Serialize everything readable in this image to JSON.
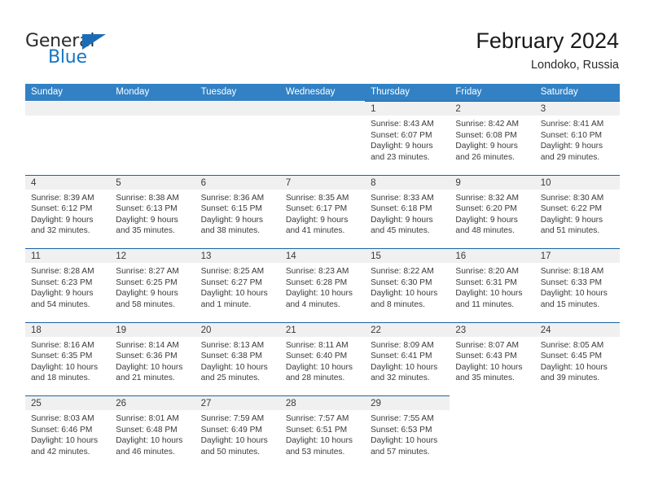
{
  "brand": {
    "name_part1": "General",
    "name_part2": "Blue",
    "triangle_icon": "brand-triangle-icon",
    "color_dark": "#2b2b2b",
    "color_blue": "#1577c4"
  },
  "header": {
    "title": "February 2024",
    "subtitle": "Londoko, Russia"
  },
  "theme": {
    "header_row_bg": "#3281c4",
    "cell_top_border": "#1b63a5",
    "date_band_bg": "#f0f0f0",
    "text": "#3a3a3a"
  },
  "calendar": {
    "weekdays": [
      "Sunday",
      "Monday",
      "Tuesday",
      "Wednesday",
      "Thursday",
      "Friday",
      "Saturday"
    ],
    "weeks": [
      [
        {
          "date": "",
          "sunrise": "",
          "sunset": "",
          "daylight_line1": "",
          "daylight_line2": ""
        },
        {
          "date": "",
          "sunrise": "",
          "sunset": "",
          "daylight_line1": "",
          "daylight_line2": ""
        },
        {
          "date": "",
          "sunrise": "",
          "sunset": "",
          "daylight_line1": "",
          "daylight_line2": ""
        },
        {
          "date": "",
          "sunrise": "",
          "sunset": "",
          "daylight_line1": "",
          "daylight_line2": ""
        },
        {
          "date": "1",
          "sunrise": "Sunrise: 8:43 AM",
          "sunset": "Sunset: 6:07 PM",
          "daylight_line1": "Daylight: 9 hours",
          "daylight_line2": "and 23 minutes."
        },
        {
          "date": "2",
          "sunrise": "Sunrise: 8:42 AM",
          "sunset": "Sunset: 6:08 PM",
          "daylight_line1": "Daylight: 9 hours",
          "daylight_line2": "and 26 minutes."
        },
        {
          "date": "3",
          "sunrise": "Sunrise: 8:41 AM",
          "sunset": "Sunset: 6:10 PM",
          "daylight_line1": "Daylight: 9 hours",
          "daylight_line2": "and 29 minutes."
        }
      ],
      [
        {
          "date": "4",
          "sunrise": "Sunrise: 8:39 AM",
          "sunset": "Sunset: 6:12 PM",
          "daylight_line1": "Daylight: 9 hours",
          "daylight_line2": "and 32 minutes."
        },
        {
          "date": "5",
          "sunrise": "Sunrise: 8:38 AM",
          "sunset": "Sunset: 6:13 PM",
          "daylight_line1": "Daylight: 9 hours",
          "daylight_line2": "and 35 minutes."
        },
        {
          "date": "6",
          "sunrise": "Sunrise: 8:36 AM",
          "sunset": "Sunset: 6:15 PM",
          "daylight_line1": "Daylight: 9 hours",
          "daylight_line2": "and 38 minutes."
        },
        {
          "date": "7",
          "sunrise": "Sunrise: 8:35 AM",
          "sunset": "Sunset: 6:17 PM",
          "daylight_line1": "Daylight: 9 hours",
          "daylight_line2": "and 41 minutes."
        },
        {
          "date": "8",
          "sunrise": "Sunrise: 8:33 AM",
          "sunset": "Sunset: 6:18 PM",
          "daylight_line1": "Daylight: 9 hours",
          "daylight_line2": "and 45 minutes."
        },
        {
          "date": "9",
          "sunrise": "Sunrise: 8:32 AM",
          "sunset": "Sunset: 6:20 PM",
          "daylight_line1": "Daylight: 9 hours",
          "daylight_line2": "and 48 minutes."
        },
        {
          "date": "10",
          "sunrise": "Sunrise: 8:30 AM",
          "sunset": "Sunset: 6:22 PM",
          "daylight_line1": "Daylight: 9 hours",
          "daylight_line2": "and 51 minutes."
        }
      ],
      [
        {
          "date": "11",
          "sunrise": "Sunrise: 8:28 AM",
          "sunset": "Sunset: 6:23 PM",
          "daylight_line1": "Daylight: 9 hours",
          "daylight_line2": "and 54 minutes."
        },
        {
          "date": "12",
          "sunrise": "Sunrise: 8:27 AM",
          "sunset": "Sunset: 6:25 PM",
          "daylight_line1": "Daylight: 9 hours",
          "daylight_line2": "and 58 minutes."
        },
        {
          "date": "13",
          "sunrise": "Sunrise: 8:25 AM",
          "sunset": "Sunset: 6:27 PM",
          "daylight_line1": "Daylight: 10 hours",
          "daylight_line2": "and 1 minute."
        },
        {
          "date": "14",
          "sunrise": "Sunrise: 8:23 AM",
          "sunset": "Sunset: 6:28 PM",
          "daylight_line1": "Daylight: 10 hours",
          "daylight_line2": "and 4 minutes."
        },
        {
          "date": "15",
          "sunrise": "Sunrise: 8:22 AM",
          "sunset": "Sunset: 6:30 PM",
          "daylight_line1": "Daylight: 10 hours",
          "daylight_line2": "and 8 minutes."
        },
        {
          "date": "16",
          "sunrise": "Sunrise: 8:20 AM",
          "sunset": "Sunset: 6:31 PM",
          "daylight_line1": "Daylight: 10 hours",
          "daylight_line2": "and 11 minutes."
        },
        {
          "date": "17",
          "sunrise": "Sunrise: 8:18 AM",
          "sunset": "Sunset: 6:33 PM",
          "daylight_line1": "Daylight: 10 hours",
          "daylight_line2": "and 15 minutes."
        }
      ],
      [
        {
          "date": "18",
          "sunrise": "Sunrise: 8:16 AM",
          "sunset": "Sunset: 6:35 PM",
          "daylight_line1": "Daylight: 10 hours",
          "daylight_line2": "and 18 minutes."
        },
        {
          "date": "19",
          "sunrise": "Sunrise: 8:14 AM",
          "sunset": "Sunset: 6:36 PM",
          "daylight_line1": "Daylight: 10 hours",
          "daylight_line2": "and 21 minutes."
        },
        {
          "date": "20",
          "sunrise": "Sunrise: 8:13 AM",
          "sunset": "Sunset: 6:38 PM",
          "daylight_line1": "Daylight: 10 hours",
          "daylight_line2": "and 25 minutes."
        },
        {
          "date": "21",
          "sunrise": "Sunrise: 8:11 AM",
          "sunset": "Sunset: 6:40 PM",
          "daylight_line1": "Daylight: 10 hours",
          "daylight_line2": "and 28 minutes."
        },
        {
          "date": "22",
          "sunrise": "Sunrise: 8:09 AM",
          "sunset": "Sunset: 6:41 PM",
          "daylight_line1": "Daylight: 10 hours",
          "daylight_line2": "and 32 minutes."
        },
        {
          "date": "23",
          "sunrise": "Sunrise: 8:07 AM",
          "sunset": "Sunset: 6:43 PM",
          "daylight_line1": "Daylight: 10 hours",
          "daylight_line2": "and 35 minutes."
        },
        {
          "date": "24",
          "sunrise": "Sunrise: 8:05 AM",
          "sunset": "Sunset: 6:45 PM",
          "daylight_line1": "Daylight: 10 hours",
          "daylight_line2": "and 39 minutes."
        }
      ],
      [
        {
          "date": "25",
          "sunrise": "Sunrise: 8:03 AM",
          "sunset": "Sunset: 6:46 PM",
          "daylight_line1": "Daylight: 10 hours",
          "daylight_line2": "and 42 minutes."
        },
        {
          "date": "26",
          "sunrise": "Sunrise: 8:01 AM",
          "sunset": "Sunset: 6:48 PM",
          "daylight_line1": "Daylight: 10 hours",
          "daylight_line2": "and 46 minutes."
        },
        {
          "date": "27",
          "sunrise": "Sunrise: 7:59 AM",
          "sunset": "Sunset: 6:49 PM",
          "daylight_line1": "Daylight: 10 hours",
          "daylight_line2": "and 50 minutes."
        },
        {
          "date": "28",
          "sunrise": "Sunrise: 7:57 AM",
          "sunset": "Sunset: 6:51 PM",
          "daylight_line1": "Daylight: 10 hours",
          "daylight_line2": "and 53 minutes."
        },
        {
          "date": "29",
          "sunrise": "Sunrise: 7:55 AM",
          "sunset": "Sunset: 6:53 PM",
          "daylight_line1": "Daylight: 10 hours",
          "daylight_line2": "and 57 minutes."
        },
        {
          "date": "",
          "sunrise": "",
          "sunset": "",
          "daylight_line1": "",
          "daylight_line2": ""
        },
        {
          "date": "",
          "sunrise": "",
          "sunset": "",
          "daylight_line1": "",
          "daylight_line2": ""
        }
      ]
    ]
  }
}
